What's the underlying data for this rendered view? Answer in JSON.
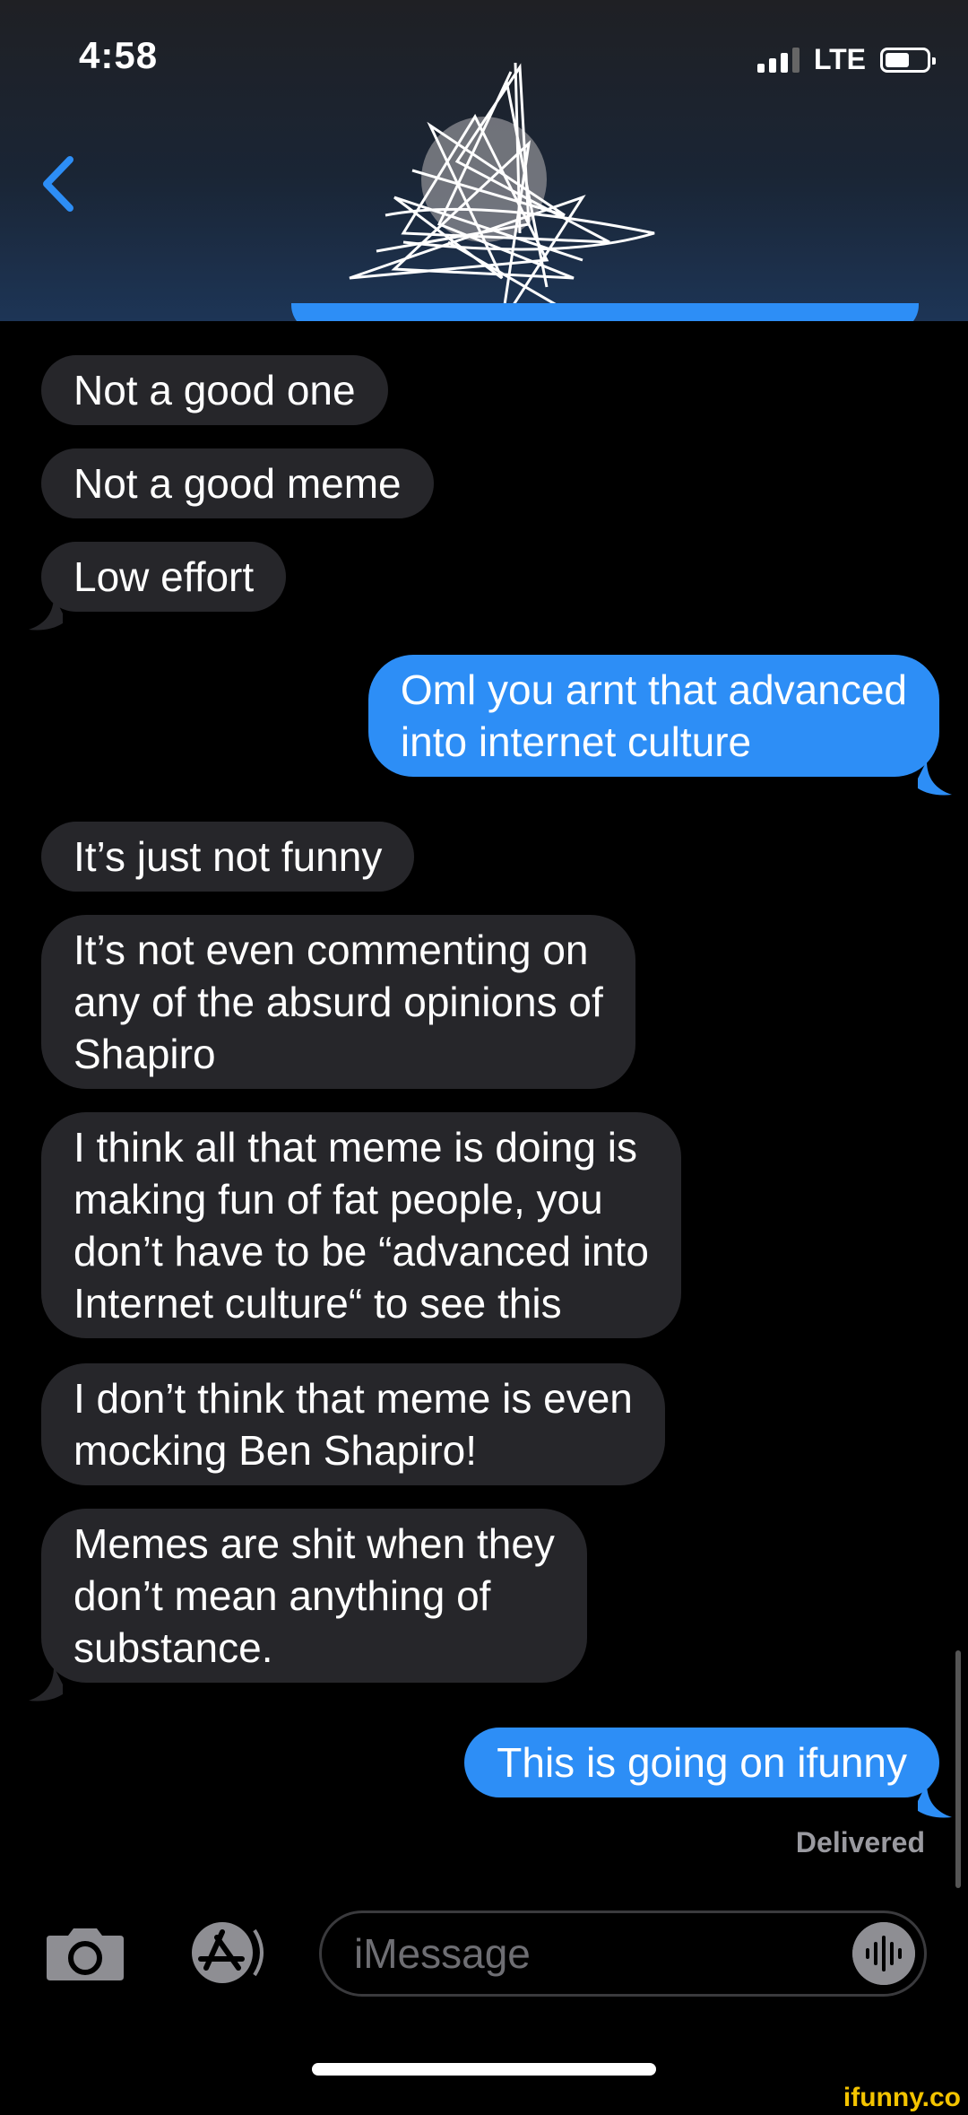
{
  "status_bar": {
    "time": "4:58",
    "network": "LTE"
  },
  "conversation": {
    "messages": [
      {
        "dir": "in",
        "text": "Not a good one"
      },
      {
        "dir": "in",
        "text": "Not a good meme"
      },
      {
        "dir": "in",
        "text": "Low effort"
      },
      {
        "dir": "out",
        "text": "Oml you arnt that advanced\ninto internet culture"
      },
      {
        "dir": "in",
        "text": "It’s just not funny"
      },
      {
        "dir": "in",
        "text": "It’s not even commenting on\nany of the absurd opinions of\nShapiro"
      },
      {
        "dir": "in",
        "text": "I think all that meme is doing is\nmaking fun of fat people, you\ndon’t have to be “advanced into\nInternet culture“ to see this"
      },
      {
        "dir": "in",
        "text": "I don’t think that meme is even\nmocking Ben Shapiro!"
      },
      {
        "dir": "in",
        "text": "Memes are shit when they\ndon’t mean anything of\nsubstance."
      },
      {
        "dir": "out",
        "text": "This is going on ifunny"
      }
    ],
    "delivered_label": "Delivered"
  },
  "composer": {
    "placeholder": "iMessage"
  },
  "watermark": "ifunny.co",
  "colors": {
    "outgoing": "#2d8ef6",
    "incoming": "#26262a",
    "back_arrow": "#2d8ef6"
  }
}
